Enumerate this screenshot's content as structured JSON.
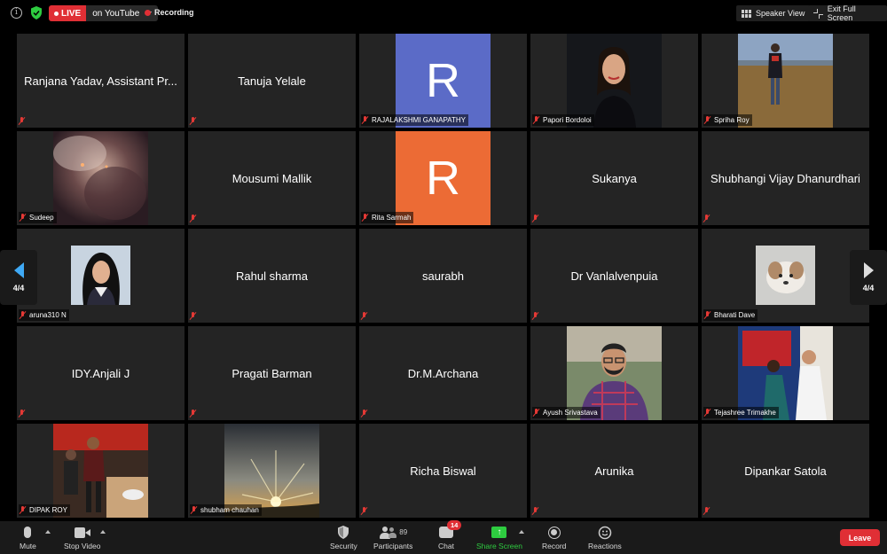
{
  "topbar": {
    "live_label": "LIVE",
    "live_platform": "on YouTube",
    "recording_label": "Recording",
    "speaker_view_label": "Speaker View",
    "exit_fullscreen_label": "Exit Full Screen"
  },
  "pager": {
    "left_label": "4/4",
    "right_label": "4/4"
  },
  "participants": [
    {
      "name": "Ranjana Yadav, Assistant Pr...",
      "display": "name"
    },
    {
      "name": "Tanuja Yelale",
      "display": "name"
    },
    {
      "name": "RAJALAKSHMI GANAPATHY",
      "display": "avatar",
      "initial": "R",
      "avatar_color": "#5b6bc7"
    },
    {
      "name": "Papori Bordoloi",
      "display": "photo"
    },
    {
      "name": "Spriha Roy",
      "display": "photo"
    },
    {
      "name": "Sudeep",
      "display": "photo"
    },
    {
      "name": "Mousumi Mallik",
      "display": "name"
    },
    {
      "name": "Rita Sarmah",
      "display": "avatar",
      "initial": "R",
      "avatar_color": "#ec6b35"
    },
    {
      "name": "Sukanya",
      "display": "name"
    },
    {
      "name": "Shubhangi Vijay Dhanurdhari",
      "display": "name"
    },
    {
      "name": "aruna310 N",
      "display": "photo"
    },
    {
      "name": "Rahul sharma",
      "display": "name"
    },
    {
      "name": "saurabh",
      "display": "name"
    },
    {
      "name": "Dr Vanlalvenpuia",
      "display": "name"
    },
    {
      "name": "Bharati Dave",
      "display": "photo"
    },
    {
      "name": "IDY.Anjali J",
      "display": "name"
    },
    {
      "name": "Pragati Barman",
      "display": "name"
    },
    {
      "name": "Dr.M.Archana",
      "display": "name"
    },
    {
      "name": "Ayush Srivastava",
      "display": "photo"
    },
    {
      "name": "Tejashree Trimakhe",
      "display": "photo"
    },
    {
      "name": "DIPAK ROY",
      "display": "photo"
    },
    {
      "name": "shubham chauhan",
      "display": "photo"
    },
    {
      "name": "Richa Biswal",
      "display": "name"
    },
    {
      "name": "Arunika",
      "display": "name"
    },
    {
      "name": "Dipankar Satola",
      "display": "name"
    }
  ],
  "toolbar": {
    "mute_label": "Mute",
    "stop_video_label": "Stop Video",
    "security_label": "Security",
    "participants_label": "Participants",
    "participants_count": "89",
    "chat_label": "Chat",
    "chat_badge": "14",
    "share_screen_label": "Share Screen",
    "record_label": "Record",
    "reactions_label": "Reactions",
    "leave_label": "Leave"
  },
  "colors": {
    "accent_red": "#e02f35",
    "share_green": "#2ecc40",
    "tile_bg": "#242424"
  }
}
